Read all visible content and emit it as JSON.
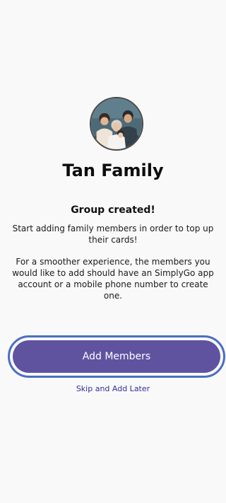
{
  "group": {
    "name": "Tan Family",
    "avatar_icon": "family-photo"
  },
  "status": {
    "title": "Group created!",
    "message": "Start adding family members in order to top up their cards!",
    "hint": "For a smoother experience, the members you would like to add should have an SimplyGo app account or a mobile phone number to create one."
  },
  "actions": {
    "add_members_label": "Add Members",
    "skip_label": "Skip and Add Later"
  },
  "colors": {
    "background": "#f9f9f9",
    "primary_button": "#5f53a0",
    "focus_ring": "#4a6fc2",
    "link": "#2f2f9a"
  }
}
